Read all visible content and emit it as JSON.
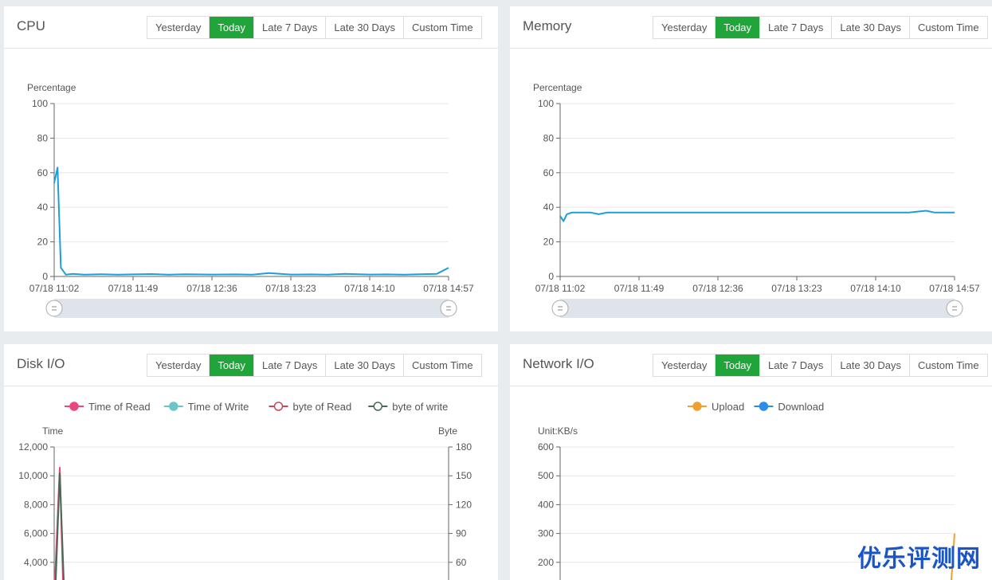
{
  "range_buttons": [
    "Yesterday",
    "Today",
    "Late 7 Days",
    "Late 30 Days",
    "Custom Time"
  ],
  "active_range": "Today",
  "colors": {
    "accent": "#20a53a",
    "cpu_line": "#1aa0d8",
    "memory_line": "#1aa0d8",
    "grid": "#e8e8e8"
  },
  "watermark": "优乐评测网",
  "panels": {
    "cpu": {
      "title": "CPU"
    },
    "memory": {
      "title": "Memory"
    },
    "disk": {
      "title": "Disk I/O"
    },
    "network": {
      "title": "Network I/O"
    }
  },
  "chart_data": [
    {
      "id": "cpu",
      "type": "line",
      "ylabel": "Percentage",
      "ylim": [
        0,
        100
      ],
      "yticks": [
        0,
        20,
        40,
        60,
        80,
        100
      ],
      "x_ticks": [
        "07/18 11:02",
        "07/18 11:49",
        "07/18 12:36",
        "07/18 13:23",
        "07/18 14:10",
        "07/18 14:57"
      ],
      "x": [
        "11:02",
        "11:04",
        "11:06",
        "11:09",
        "11:13",
        "11:20",
        "11:30",
        "11:40",
        "11:49",
        "12:00",
        "12:10",
        "12:20",
        "12:36",
        "12:50",
        "13:00",
        "13:10",
        "13:23",
        "13:35",
        "13:45",
        "13:55",
        "14:10",
        "14:20",
        "14:30",
        "14:40",
        "14:50",
        "14:57"
      ],
      "values": [
        54,
        63,
        5,
        1,
        1.5,
        1,
        1.3,
        1,
        1.2,
        1.4,
        1,
        1.3,
        1.1,
        1.2,
        1,
        2,
        1.1,
        1.2,
        1,
        1.5,
        1.1,
        1.2,
        1,
        1.3,
        1.5,
        5
      ],
      "zoom_slider": [
        0,
        100
      ],
      "grid": true
    },
    {
      "id": "memory",
      "type": "line",
      "ylabel": "Percentage",
      "ylim": [
        0,
        100
      ],
      "yticks": [
        0,
        20,
        40,
        60,
        80,
        100
      ],
      "x_ticks": [
        "07/18 11:02",
        "07/18 11:49",
        "07/18 12:36",
        "07/18 13:23",
        "07/18 14:10",
        "07/18 14:57"
      ],
      "x": [
        "11:02",
        "11:04",
        "11:06",
        "11:09",
        "11:13",
        "11:20",
        "11:25",
        "11:30",
        "11:49",
        "12:36",
        "13:23",
        "14:10",
        "14:30",
        "14:40",
        "14:45",
        "14:57"
      ],
      "values": [
        35,
        32,
        36,
        37,
        37,
        37,
        36,
        37,
        37,
        37,
        37,
        37,
        37,
        38,
        37,
        37
      ],
      "zoom_slider": [
        0,
        100
      ],
      "grid": true
    },
    {
      "id": "disk",
      "type": "line",
      "legend": [
        "Time of Read",
        "Time of Write",
        "byte of Read",
        "byte of write"
      ],
      "legend_colors": [
        "#e8487a",
        "#6cc6c8",
        "#c44a5a",
        "#4a6a55"
      ],
      "ylabel_left": "Time",
      "ylabel_right": "Byte",
      "yticks_left": [
        "12,000",
        "10,000",
        "8,000",
        "6,000",
        "4,000"
      ],
      "yticks_right": [
        "180",
        "150",
        "120",
        "90",
        "60"
      ],
      "ylim_left": [
        0,
        12000
      ],
      "ylim_right": [
        0,
        180
      ],
      "series_visible_peak": {
        "time_of_read": 10600,
        "byte_of_write": 10200
      },
      "grid": true
    },
    {
      "id": "network",
      "type": "line",
      "legend": [
        "Upload",
        "Download"
      ],
      "legend_colors": [
        "#f0a030",
        "#2a8fe8"
      ],
      "ylabel": "Unit:KB/s",
      "yticks": [
        "600",
        "500",
        "400",
        "300",
        "200"
      ],
      "ylim": [
        0,
        600
      ],
      "upload_end_value": 300,
      "grid": true
    }
  ]
}
